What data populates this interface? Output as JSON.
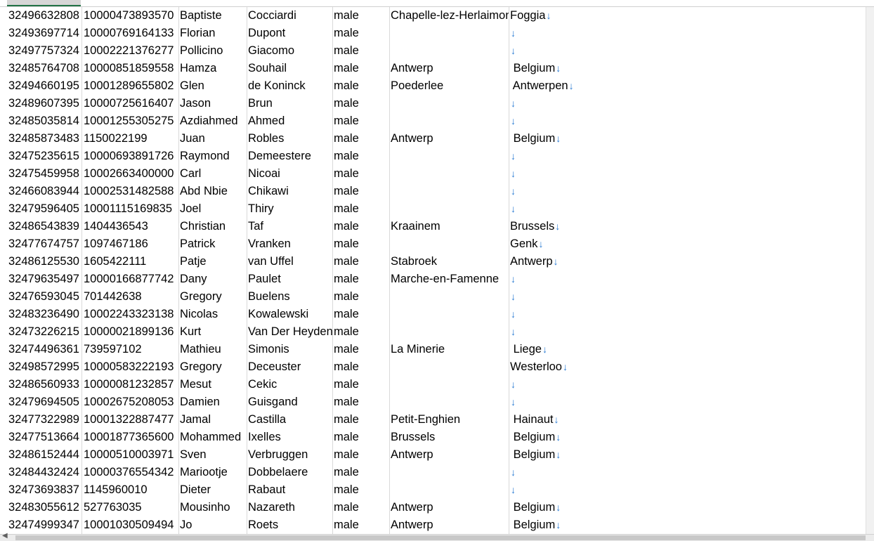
{
  "colors": {
    "arrow": "#2b7cd3",
    "gridline": "#d9d9d9",
    "selected_header_underline": "#217346"
  },
  "icons": {
    "line_break_marker": "arrow-down-icon",
    "scroll_left": "scroll-left-arrow-icon"
  },
  "rows": [
    [
      "32496632808",
      "10000473893570",
      "Baptiste",
      "Cocciardi",
      "male",
      "Chapelle-lez-Herlaimont",
      "Foggia"
    ],
    [
      "32493697714",
      "10000769164133",
      "Florian",
      "Dupont",
      "male",
      "",
      ""
    ],
    [
      "32497757324",
      "10002221376277",
      "Pollicino",
      "Giacomo",
      "male",
      "",
      ""
    ],
    [
      "32485764708",
      "10000851859558",
      "Hamza",
      "Souhail",
      "male",
      "Antwerp",
      " Belgium"
    ],
    [
      "32494660195",
      "10001289655802",
      "Glen",
      "de Koninck",
      "male",
      "Poederlee",
      " Antwerpen"
    ],
    [
      "32489607395",
      "10000725616407",
      "Jason",
      "Brun",
      "male",
      "",
      ""
    ],
    [
      "32485035814",
      "10001255305275",
      "Azdiahmed",
      "Ahmed",
      "male",
      "",
      ""
    ],
    [
      "32485873483",
      "1150022199",
      "Juan",
      "Robles",
      "male",
      "Antwerp",
      " Belgium"
    ],
    [
      "32475235615",
      "10000693891726",
      "Raymond",
      "Demeestere",
      "male",
      "",
      ""
    ],
    [
      "32475459958",
      "10002663400000",
      "Carl",
      "Nicoai",
      "male",
      "",
      ""
    ],
    [
      "32466083944",
      "10002531482588",
      "Abd Nbie",
      "Chikawi",
      "male",
      "",
      ""
    ],
    [
      "32479596405",
      "10001115169835",
      "Joel",
      "Thiry",
      "male",
      "",
      ""
    ],
    [
      "32486543839",
      "1404436543",
      "Christian",
      "Taf",
      "male",
      "Kraainem",
      "Brussels"
    ],
    [
      "32477674757",
      "1097467186",
      "Patrick",
      "Vranken",
      "male",
      "",
      "Genk"
    ],
    [
      "32486125530",
      "1605422111",
      "Patje",
      "van Uffel",
      "male",
      "Stabroek",
      "Antwerp"
    ],
    [
      "32479635497",
      "10000166877742",
      "Dany",
      "Paulet",
      "male",
      "Marche-en-Famenne",
      ""
    ],
    [
      "32476593045",
      "701442638",
      "Gregory",
      "Buelens",
      "male",
      "",
      ""
    ],
    [
      "32483236490",
      "10002243323138",
      "Nicolas",
      "Kowalewski",
      "male",
      "",
      ""
    ],
    [
      "32473226215",
      "10000021899136",
      "Kurt",
      "Van Der Heyden",
      "male",
      "",
      ""
    ],
    [
      "32474496361",
      "739597102",
      "Mathieu",
      "Simonis",
      "male",
      "La Minerie",
      " Liege"
    ],
    [
      "32498572995",
      "10000583222193",
      "Gregory",
      "Deceuster",
      "male",
      "",
      "Westerloo"
    ],
    [
      "32486560933",
      "10000081232857",
      "Mesut",
      "Cekic",
      "male",
      "",
      ""
    ],
    [
      "32479694505",
      "10002675208053",
      "Damien",
      "Guisgand",
      "male",
      "",
      ""
    ],
    [
      "32477322989",
      "10001322887477",
      "Jamal",
      "Castilla",
      "male",
      "Petit-Enghien",
      " Hainaut"
    ],
    [
      "32477513664",
      "10001877365600",
      "Mohammed",
      "Ixelles",
      "male",
      "Brussels",
      " Belgium"
    ],
    [
      "32486152444",
      "10000510003971",
      "Sven",
      "Verbruggen",
      "male",
      "Antwerp",
      " Belgium"
    ],
    [
      "32484432424",
      "10000376554342",
      "Mariootje",
      "Dobbelaere",
      "male",
      "",
      ""
    ],
    [
      "32473693837",
      "1145960010",
      "Dieter",
      "Rabaut",
      "male",
      "",
      ""
    ],
    [
      "32483055612",
      "527763035",
      "Mousinho",
      "Nazareth",
      "male",
      "Antwerp",
      " Belgium"
    ],
    [
      "32474999347",
      "10001030509494",
      "Jo",
      "Roets",
      "male",
      "Antwerp",
      " Belgium"
    ]
  ]
}
